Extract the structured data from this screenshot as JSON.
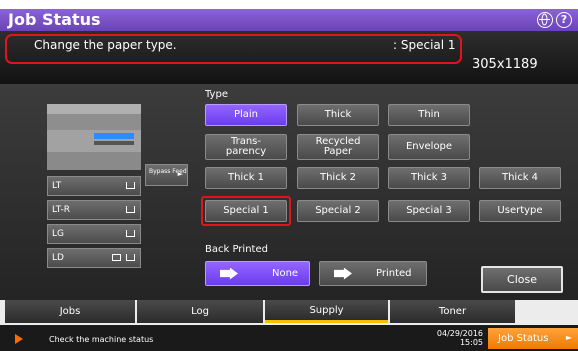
{
  "header": {
    "title": "Job Status",
    "globe_icon": "globe-icon",
    "help_icon": "help-icon",
    "help_glyph": "?"
  },
  "message": {
    "text": "Change the paper type.",
    "value": ": Special 1",
    "size": "305x1189"
  },
  "type_section": {
    "label": "Type",
    "buttons": [
      "Plain",
      "Thick",
      "Thin",
      "Trans-parency",
      "Recycled Paper",
      "Envelope",
      "Thick 1",
      "Thick 2",
      "Thick 3",
      "Thick 4",
      "Special 1",
      "Special 2",
      "Special 3",
      "Usertype"
    ],
    "selected": "Plain",
    "highlighted": "Special 1"
  },
  "back_printed": {
    "label": "Back Printed",
    "none_label": "None",
    "printed_label": "Printed",
    "selected": "None"
  },
  "close_label": "Close",
  "machine": {
    "bypass_label": "Bypass Feed",
    "bypass_arrow": "►",
    "trays": [
      "LT",
      "LT-R",
      "LG",
      "LD"
    ]
  },
  "tabs": [
    "Jobs",
    "Log",
    "Supply",
    "Toner"
  ],
  "active_tab": "Supply",
  "status": {
    "text": "Check the machine status",
    "date": "04/29/2016",
    "time": "15:05",
    "job_status_button": "Job Status",
    "job_status_arrow": "►"
  },
  "colors": {
    "accent_purple": "#7a4cf5",
    "highlight_red": "#e0141c",
    "tab_indicator": "#f2c200",
    "job_status_orange": "#f58a1a"
  }
}
